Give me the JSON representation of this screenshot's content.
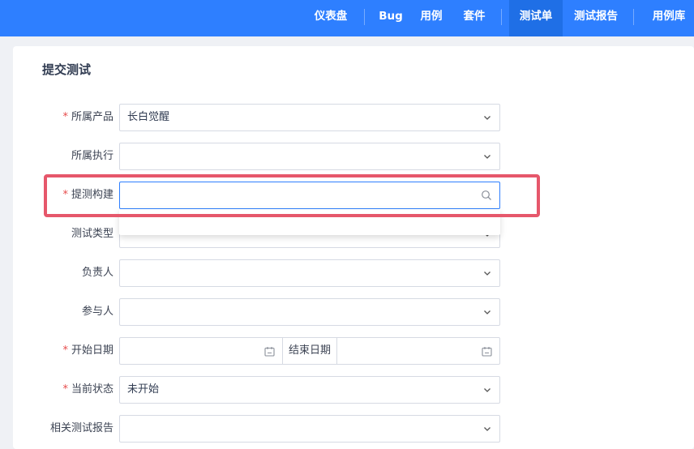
{
  "nav": {
    "items": [
      {
        "label": "仪表盘",
        "active": false
      },
      {
        "label": "Bug",
        "active": false
      },
      {
        "label": "用例",
        "active": false
      },
      {
        "label": "套件",
        "active": false
      },
      {
        "label": "测试单",
        "active": true
      },
      {
        "label": "测试报告",
        "active": false
      },
      {
        "label": "用例库",
        "active": false
      }
    ]
  },
  "form": {
    "title": "提交测试",
    "required_mark": "*",
    "product": {
      "label": "所属产品",
      "value": "长白觉醒"
    },
    "execution": {
      "label": "所属执行",
      "value": ""
    },
    "build": {
      "label": "提测构建",
      "value": ""
    },
    "test_type": {
      "label": "测试类型",
      "value": ""
    },
    "owner": {
      "label": "负责人",
      "value": ""
    },
    "participants": {
      "label": "参与人",
      "value": ""
    },
    "start_date": {
      "label": "开始日期",
      "value": ""
    },
    "end_date": {
      "label": "结束日期",
      "value": ""
    },
    "status": {
      "label": "当前状态",
      "value": "未开始"
    },
    "related_report": {
      "label": "相关测试报告",
      "value": ""
    }
  },
  "colors": {
    "accent": "#2e7fff",
    "required": "#e64a4a",
    "highlight": "#e6576b"
  }
}
